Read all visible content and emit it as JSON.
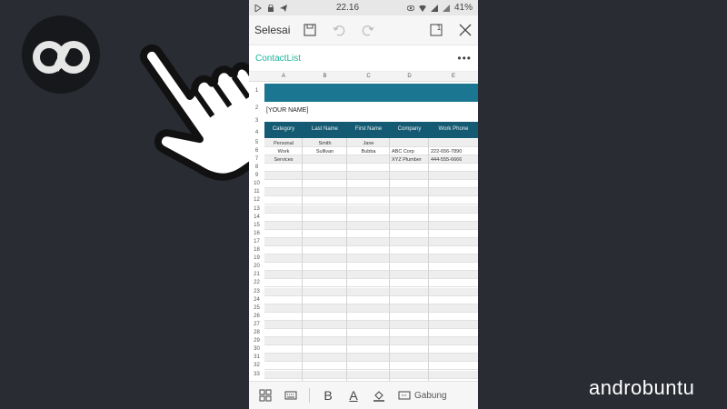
{
  "statusbar": {
    "time": "22.16",
    "battery": "41%"
  },
  "toolbar": {
    "done_label": "Selesai",
    "sheet_count": "1"
  },
  "document": {
    "name": "ContactList",
    "more": "•••"
  },
  "columns": [
    "A",
    "B",
    "C",
    "D",
    "E"
  ],
  "sheet": {
    "name_placeholder": "[YOUR NAME]",
    "headers": [
      "Category",
      "Last Name",
      "First Name",
      "Company",
      "Work Phone"
    ],
    "rows": [
      [
        "Personal",
        "Smith",
        "Jane",
        "",
        ""
      ],
      [
        "Work",
        "Sullivan",
        "Bubba",
        "ABC Corp",
        "222-656-7890"
      ],
      [
        "Services",
        "",
        "",
        "XYZ Plumber",
        "444-555-6666"
      ]
    ],
    "row_numbers": [
      "1",
      "2",
      "3",
      "4",
      "5",
      "6",
      "7",
      "8",
      "9",
      "10",
      "11",
      "12",
      "13",
      "14",
      "15",
      "16",
      "17",
      "18",
      "19",
      "20",
      "21",
      "22",
      "23",
      "24",
      "25",
      "26",
      "27",
      "28",
      "29",
      "30",
      "31",
      "32",
      "33"
    ]
  },
  "bottombar": {
    "merge_label": "Gabung",
    "bold": "B",
    "font_color": "A"
  },
  "watermark": {
    "text": "androbuntu"
  },
  "colors": {
    "accent_green": "#1db49a",
    "banner_blue": "#1a7691",
    "header_blue": "#135a72",
    "background": "#292c33"
  }
}
